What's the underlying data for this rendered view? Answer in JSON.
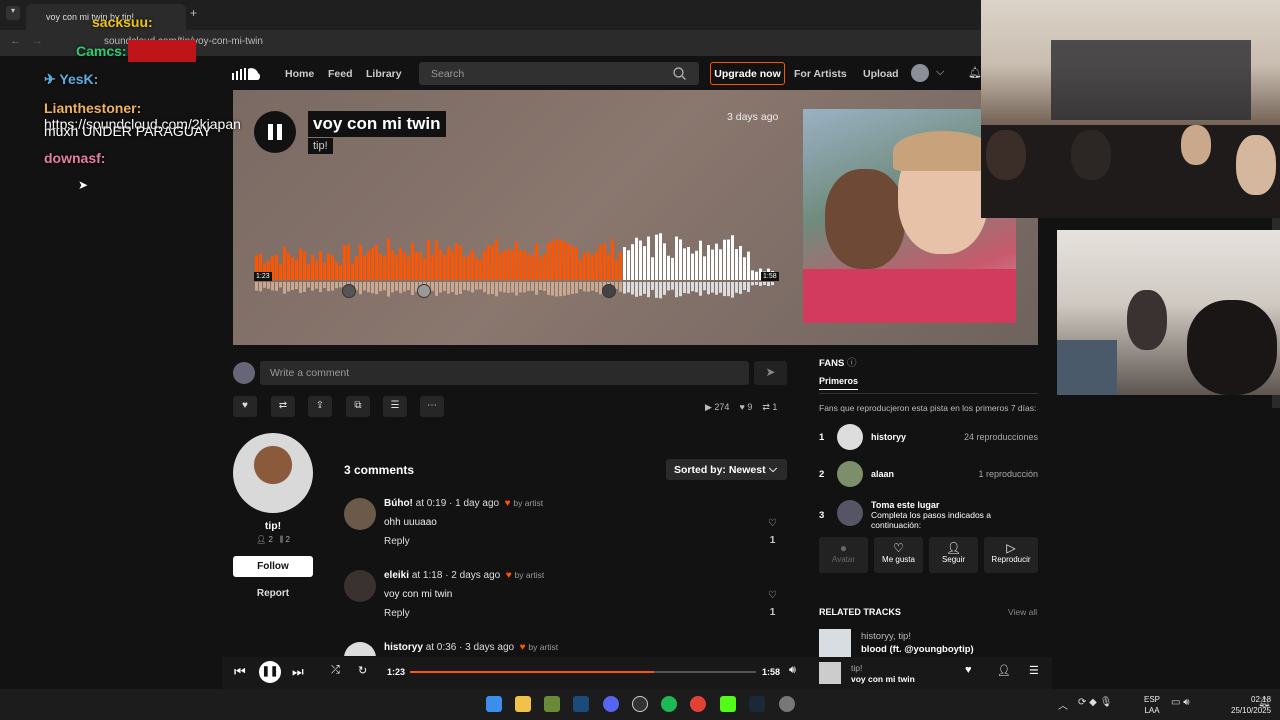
{
  "browser": {
    "tab_title": "voy con mi twin by tip!",
    "url": "soundcloud.com/tip/voy-con-mi-twin"
  },
  "nav": {
    "home": "Home",
    "feed": "Feed",
    "library": "Library",
    "search_placeholder": "Search",
    "upgrade": "Upgrade now",
    "for_artists": "For Artists",
    "upload": "Upload"
  },
  "track": {
    "title": "voy con mi twin",
    "artist": "tip!",
    "posted": "3 days ago",
    "time_current": "1:23",
    "time_total": "1:58",
    "progress": 0.705
  },
  "comment_box": {
    "placeholder": "Write a comment"
  },
  "stats": {
    "plays": "274",
    "likes": "9",
    "reposts": "1"
  },
  "artist_card": {
    "name": "tip!",
    "followers": "2",
    "tracks": "2",
    "follow": "Follow",
    "report": "Report"
  },
  "comments": {
    "count_label": "3 comments",
    "sort_label": "Sorted by: Newest",
    "items": [
      {
        "user": "Búho!",
        "at": "at 0:19",
        "ago": "· 1 day ago",
        "by_artist": "by artist",
        "text": "ohh uuuaao",
        "reply": "Reply",
        "likes": "1"
      },
      {
        "user": "eleiki",
        "at": "at 1:18",
        "ago": "· 2 days ago",
        "by_artist": "by artist",
        "text": "voy con mi twin",
        "reply": "Reply",
        "likes": "1"
      },
      {
        "user": "historyy",
        "at": "at 0:36",
        "ago": "· 3 days ago",
        "by_artist": "by artist"
      }
    ]
  },
  "fans": {
    "title": "FANS",
    "tab": "Primeros",
    "description": "Fans que reproducjeron esta pista en los primeros 7 días:",
    "rows": [
      {
        "rank": "1",
        "name": "historyy",
        "plays": "24 reproducciones"
      },
      {
        "rank": "2",
        "name": "alaan",
        "plays": "1 reproducción"
      },
      {
        "rank": "3",
        "name": "Toma este lugar",
        "sub": "Completa los pasos indicados a continuación:"
      }
    ],
    "buttons": [
      "Avatar",
      "Me gusta",
      "Seguir",
      "Reproducir"
    ]
  },
  "related": {
    "title": "RELATED TRACKS",
    "view_all": "View all",
    "items": [
      {
        "artist": "historyy, tip!",
        "title": "blood (ft. @youngboytip)"
      }
    ]
  },
  "player": {
    "artist": "tip!",
    "title": "voy con mi twin",
    "time_current": "1:23",
    "time_total": "1:58"
  },
  "chat": [
    {
      "user": "sacksuu:",
      "text": "",
      "color": "#f1c40f"
    },
    {
      "user": "Camcs:",
      "text": "",
      "color": "#2ecc71"
    },
    {
      "user": "YesK:",
      "text": "",
      "color": "#5dade2"
    },
    {
      "user": "Lianthestoner:",
      "text": "https://soundcloud.com/2kjapan",
      "color": "#f0b35b"
    },
    {
      "user": "",
      "text": "muxh UNDER PARAGUAY",
      "color": "#ffffff"
    },
    {
      "user": "downasf:",
      "text": "",
      "color": "#e67e9c"
    }
  ],
  "taskbar": {
    "lang1": "ESP",
    "lang2": "LAA",
    "time": "02:18",
    "date": "25/10/2025"
  },
  "colors": {
    "accent": "#ff5500",
    "bg": "#121212"
  }
}
